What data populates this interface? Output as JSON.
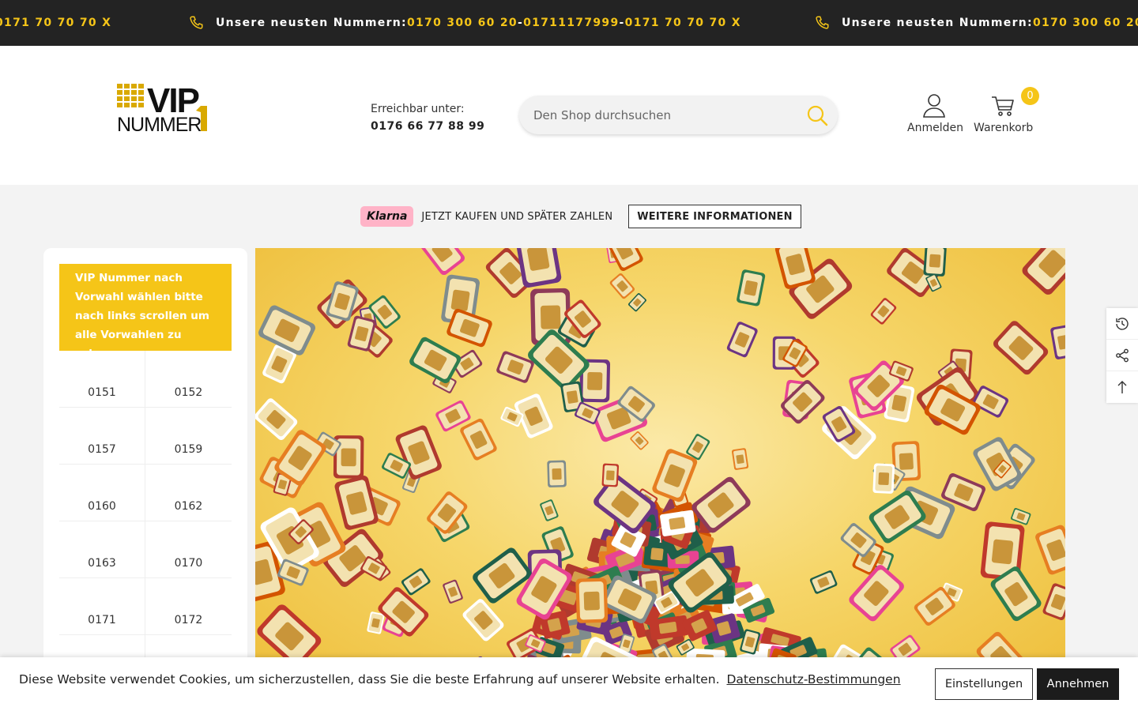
{
  "announcement": {
    "prefix": "Unsere neusten Nummern: ",
    "numbers": [
      "0170 300 60 20",
      "01711177999",
      "0171 70 70 70 X"
    ],
    "separator": " - "
  },
  "header": {
    "logo_alt": "VIP NUMMER1",
    "reach_label": "Erreichbar unter:",
    "reach_number": "0176 66 77 88 99",
    "search_placeholder": "Den Shop durchsuchen",
    "login_label": "Anmelden",
    "cart_label": "Warenkorb",
    "cart_count": "0"
  },
  "klarna": {
    "logo": "Klarna",
    "text": "JETZT KAUFEN UND SPÄTER ZAHLEN",
    "more_label": "WEITERE INFORMATIONEN"
  },
  "sidebar": {
    "heading": "VIP Nummer nach Vorwahl wählen bitte nach links scrollen um alle Vorwahlen zu sehen",
    "prefixes": [
      "0151",
      "0152",
      "0157",
      "0159",
      "0160",
      "0162",
      "0163",
      "0170",
      "0171",
      "0172"
    ]
  },
  "cookie": {
    "text": "Diese Website verwendet Cookies, um sicherzustellen, dass Sie die beste Erfahrung auf unserer Website erhalten.",
    "link_label": "Datenschutz-Bestimmungen",
    "settings_label": "Einstellungen",
    "accept_label": "Annehmen"
  },
  "colors": {
    "accent": "#f5c518",
    "topbar": "#232323",
    "klarna_pink": "#ffb3c7"
  },
  "icons": [
    "phone-icon",
    "search-icon",
    "user-icon",
    "cart-icon",
    "history-icon",
    "share-icon",
    "arrow-up-icon"
  ]
}
